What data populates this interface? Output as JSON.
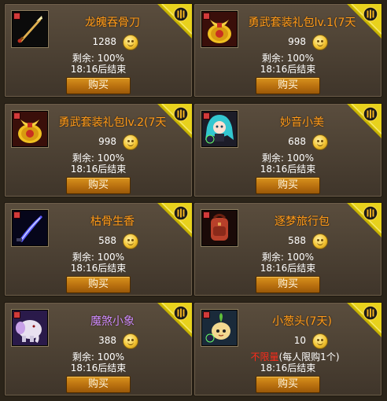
{
  "items": [
    {
      "name": "龙魄吞骨刀",
      "price": "1288",
      "remain": "剩余: 100%",
      "ends": "18:16后结束",
      "buy": "购买",
      "icon": "blade-icon",
      "name_color": "orange"
    },
    {
      "name": "勇武套装礼包lv.1(7天",
      "price": "998",
      "remain": "剩余: 100%",
      "ends": "18:16后结束",
      "buy": "购买",
      "icon": "gift-bag-icon",
      "name_color": "orange"
    },
    {
      "name": "勇武套装礼包lv.2(7天",
      "price": "998",
      "remain": "剩余: 100%",
      "ends": "18:16后结束",
      "buy": "购买",
      "icon": "gift-bag-icon",
      "name_color": "orange"
    },
    {
      "name": "妙音小美",
      "price": "688",
      "remain": "剩余: 100%",
      "ends": "18:16后结束",
      "buy": "购买",
      "icon": "anime-girl-pet-icon",
      "name_color": "orange"
    },
    {
      "name": "枯骨生香",
      "price": "588",
      "remain": "剩余: 100%",
      "ends": "18:16后结束",
      "buy": "购买",
      "icon": "dark-blade-icon",
      "name_color": "orange"
    },
    {
      "name": "逐梦旅行包",
      "price": "588",
      "remain": "剩余: 100%",
      "ends": "18:16后结束",
      "buy": "购买",
      "icon": "backpack-icon",
      "name_color": "orange"
    },
    {
      "name": "魔煞小象",
      "price": "388",
      "remain": "剩余: 100%",
      "ends": "18:16后结束",
      "buy": "购买",
      "icon": "elephant-pet-icon",
      "name_color": "purple"
    },
    {
      "name": "小葱头(7天)",
      "price": "10",
      "remain_red": "不限量",
      "remain_suffix": "(每人限购1个)",
      "ends": "18:16后结束",
      "buy": "购买",
      "icon": "onion-pet-icon",
      "name_color": "orange"
    }
  ],
  "colors": {
    "name_orange": "#ff9a1a",
    "name_purple": "#c98aff",
    "button": "#c07814",
    "card_bg": "#4e4335",
    "red_text": "#ff2a1a"
  },
  "corner_badge_icon": "hot-sale-corner-icon",
  "currency_icon": "gold-coin-icon"
}
